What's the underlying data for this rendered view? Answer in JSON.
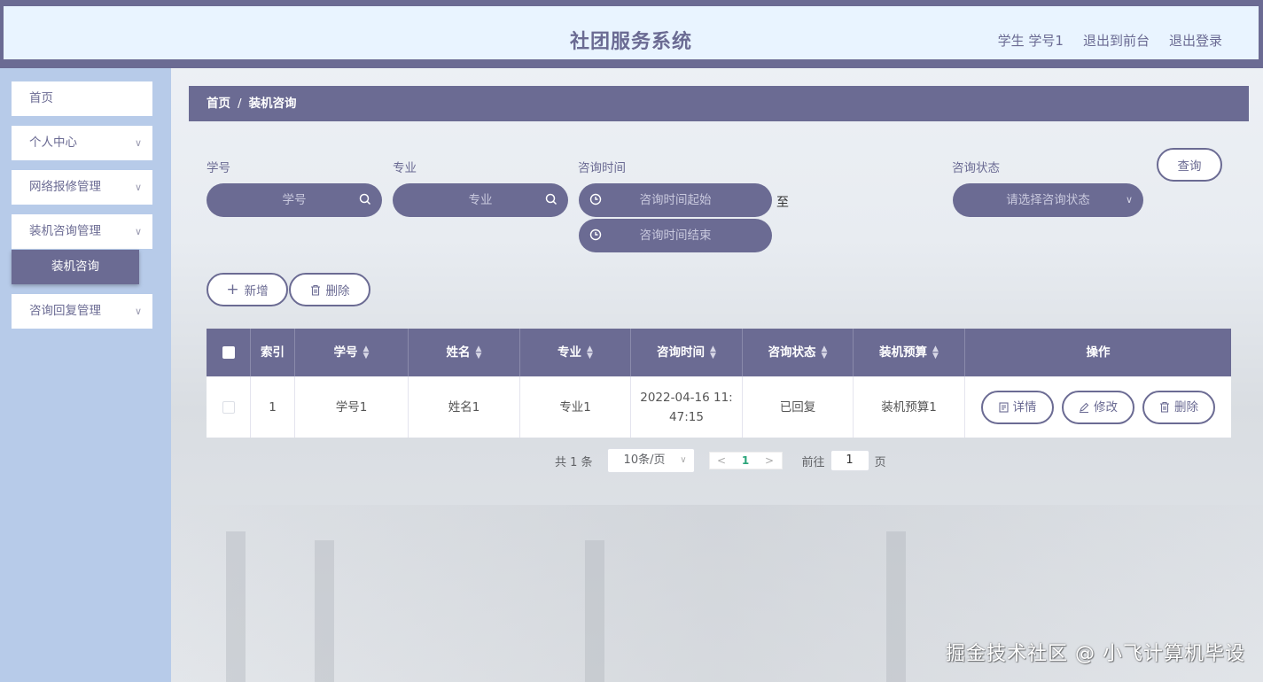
{
  "header": {
    "title": "社团服务系统",
    "user_label": "学生 学号1",
    "back_front_label": "退出到前台",
    "logout_label": "退出登录"
  },
  "sidebar": {
    "items": [
      {
        "label": "首页"
      },
      {
        "label": "个人中心"
      },
      {
        "label": "网络报修管理"
      },
      {
        "label": "装机咨询管理"
      },
      {
        "label": "咨询回复管理"
      }
    ],
    "active_sub": "装机咨询"
  },
  "breadcrumb": {
    "home": "首页",
    "sep": "/",
    "current": "装机咨询"
  },
  "filters": {
    "student_no": {
      "label": "学号",
      "placeholder": "学号"
    },
    "major": {
      "label": "专业",
      "placeholder": "专业"
    },
    "consult_time": {
      "label": "咨询时间",
      "start_placeholder": "咨询时间起始",
      "end_placeholder": "咨询时间结束",
      "to_label": "至"
    },
    "status": {
      "label": "咨询状态",
      "placeholder": "请选择咨询状态"
    },
    "query_label": "查询"
  },
  "actions": {
    "add_label": "新增",
    "delete_label": "删除"
  },
  "table": {
    "headers": [
      "索引",
      "学号",
      "姓名",
      "专业",
      "咨询时间",
      "咨询状态",
      "装机预算",
      "操作"
    ],
    "rows": [
      {
        "index": "1",
        "student_no": "学号1",
        "name": "姓名1",
        "major": "专业1",
        "time": "2022-04-16 11:47:15",
        "time_line1": "2022-04-16 11:",
        "time_line2": "47:15",
        "status": "已回复",
        "budget": "装机预算1"
      }
    ],
    "row_actions": {
      "detail": "详情",
      "edit": "修改",
      "delete": "删除"
    }
  },
  "pagination": {
    "total_text": "共 1 条",
    "page_size": "10条/页",
    "current_page": "1",
    "goto_label": "前往",
    "goto_value": "1",
    "page_unit": "页"
  },
  "watermark": "掘金技术社区 @ 小飞计算机毕设",
  "colors": {
    "primary": "#6b6b93",
    "sidebar_bg": "#b7cbe9",
    "header_inner": "#e9f4ff"
  }
}
